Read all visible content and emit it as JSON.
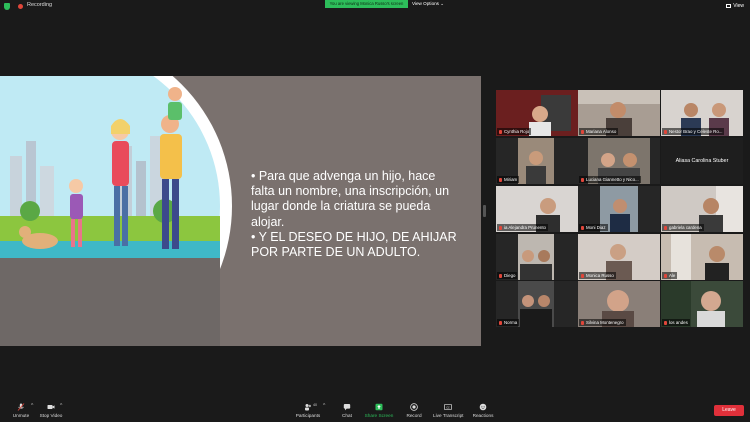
{
  "top_bar": {
    "recording_label": "Recording",
    "viewing_banner": "You are viewing Monica Russo's screen",
    "view_options_label": "View Options",
    "view_label": "View"
  },
  "slide": {
    "bullet_1": "• Para que advenga un hijo, hace falta un nombre, una inscripción, un lugar donde la criatura se pueda alojar.",
    "bullet_2": "• Y EL DESEO DE HIJO,  DE AHIJAR POR PARTE DE UN ADULTO."
  },
  "gallery": {
    "page_indicator": "2/2",
    "participants": [
      {
        "name": "Cynthia Rojo",
        "video": true
      },
      {
        "name": "Mariana Alonso",
        "video": true
      },
      {
        "name": "Nestor Brao y Celeste Ro...",
        "video": true
      },
      {
        "name": "Miriam",
        "video": true
      },
      {
        "name": "Luciana Giannetto y Nico...",
        "video": true
      },
      {
        "name": "Aliasa Carolina Stuber",
        "video": false
      },
      {
        "name": "ia Alejandra Prunento",
        "video": true
      },
      {
        "name": "Moni Diaz",
        "video": true
      },
      {
        "name": "gabriela cardena",
        "video": true
      },
      {
        "name": "Diego",
        "video": true
      },
      {
        "name": "Monica Russo",
        "video": true
      },
      {
        "name": "Ale",
        "video": true
      },
      {
        "name": "Norma",
        "video": true
      },
      {
        "name": "Silvina Montenegro",
        "video": true
      },
      {
        "name": "los andes",
        "video": true
      }
    ]
  },
  "toolbar": {
    "unmute": "Unmute",
    "stop_video": "Stop Video",
    "participants": "Participants",
    "participants_count": "40",
    "chat": "Chat",
    "share_screen": "Share Screen",
    "record": "Record",
    "live_transcript": "Live Transcript",
    "reactions": "Reactions",
    "leave": "Leave"
  },
  "colors": {
    "accent_green": "#2dbd5a",
    "leave_red": "#e0303a",
    "slide_bg": "#7a716e"
  }
}
